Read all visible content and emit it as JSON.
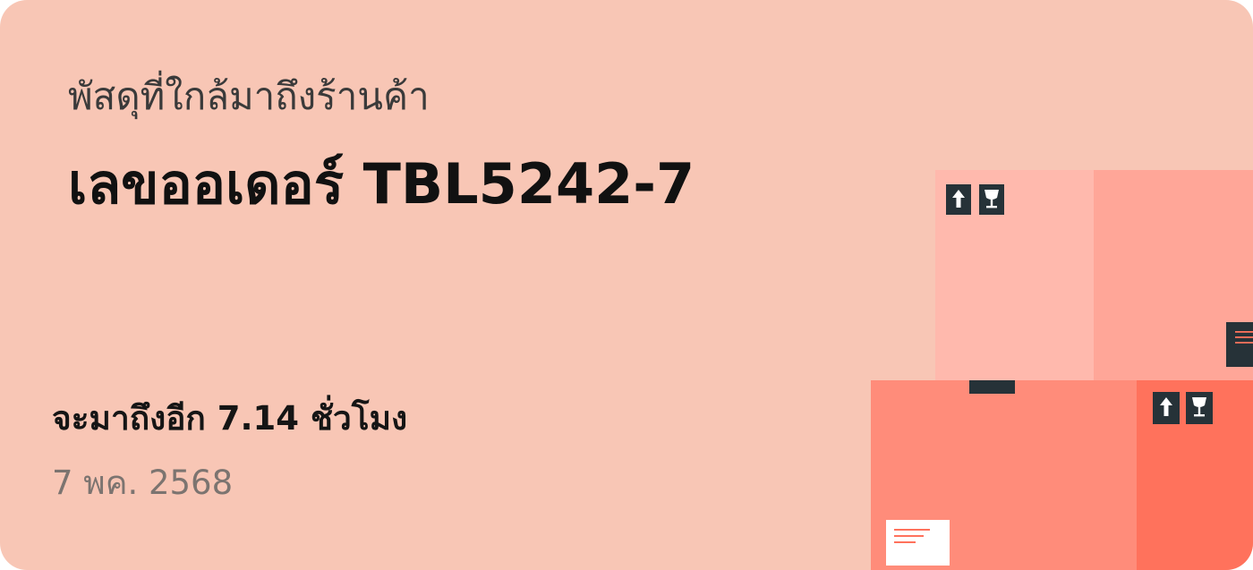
{
  "card": {
    "subtitle": "พัสดุที่ใกล้มาถึงร้านค้า",
    "order_title": "เลขออเดอร์ TBL5242-7",
    "eta": "จะมาถึงอีก 7.14 ชั่วโมง",
    "date": "7 พค. 2568"
  },
  "colors": {
    "card_background": "#f8c6b5",
    "upper_box_front": "#ffb9ad",
    "upper_box_side": "#ffa698",
    "lower_box_front": "#ff8c7a",
    "lower_box_side": "#ff725c",
    "label_dark": "#263238"
  },
  "illustration": {
    "name": "stacked-parcel-boxes",
    "icons": [
      "this-way-up-icon",
      "fragile-glass-icon"
    ]
  }
}
